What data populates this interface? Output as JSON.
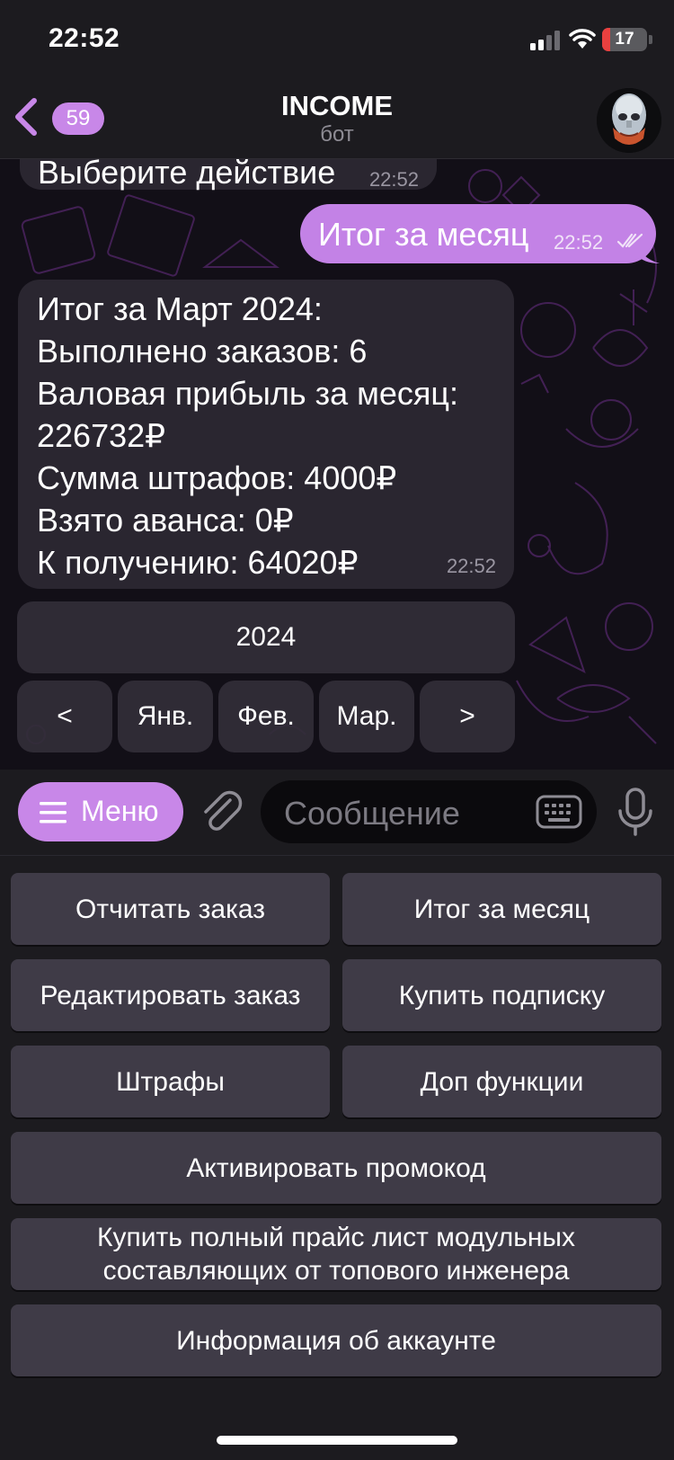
{
  "status_bar": {
    "time": "22:52",
    "battery": "17",
    "battery_level": 0.17
  },
  "nav": {
    "back_badge": "59",
    "title": "INCOME",
    "subtitle": "бот"
  },
  "chat": {
    "previous_message": {
      "text": "Выберите действие",
      "time": "22:52"
    },
    "outgoing_message": {
      "text": "Итог за месяц",
      "time": "22:52"
    },
    "report": {
      "lines": [
        "Итог за Март 2024:",
        "Выполнено заказов: 6",
        "Валовая прибыль за месяц:",
        "226732₽",
        "Сумма штрафов: 4000₽",
        "Взято аванса: 0₽",
        "К получению: 64020₽"
      ],
      "time": "22:52"
    },
    "inline_keyboard": {
      "year": "2024",
      "row": [
        "<",
        "Янв.",
        "Фев.",
        "Мар.",
        ">"
      ]
    }
  },
  "input": {
    "menu_label": "Меню",
    "placeholder": "Сообщение"
  },
  "reply_keyboard": {
    "buttons": [
      "Отчитать заказ",
      "Итог за месяц",
      "Редактировать заказ",
      "Купить подписку",
      "Штрафы",
      "Доп функции",
      "Активировать промокод",
      "Купить полный прайс лист модульных составляющих от топового инженера",
      "Информация об аккаунте"
    ]
  },
  "colors": {
    "accent": "#c887e8",
    "background": "#1c1b1f",
    "chat_background": "#120f17",
    "incoming_bubble": "#2a2630",
    "keyboard_button": "#3f3b47"
  },
  "icons": [
    "signal-icon",
    "wifi-icon",
    "battery-icon",
    "back-chevron-icon",
    "menu-icon",
    "attach-icon",
    "keyboard-icon",
    "mic-icon",
    "read-checks-icon"
  ]
}
